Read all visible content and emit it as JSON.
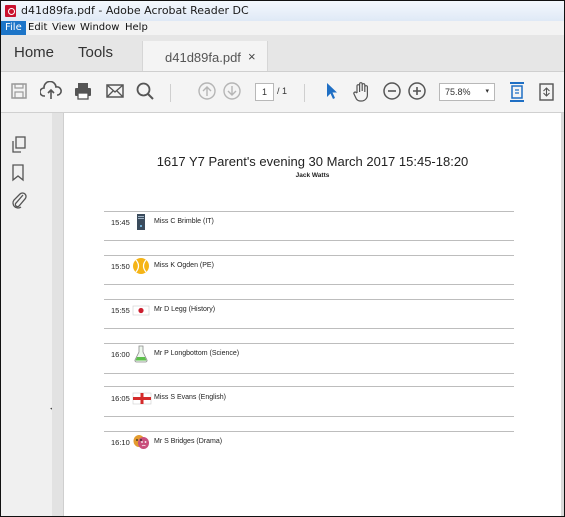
{
  "window": {
    "title": "d41d89fa.pdf - Adobe Acrobat Reader DC"
  },
  "menu": {
    "file": "File",
    "edit": "Edit",
    "view": "View",
    "window": "Window",
    "help": "Help"
  },
  "tabs": {
    "home": "Home",
    "tools": "Tools",
    "document": "d41d89fa.pdf",
    "close": "×"
  },
  "toolbar": {
    "page_current": "1",
    "page_total": "/ 1",
    "zoom": "75.8%",
    "zoom_arrow": "▾"
  },
  "sidebar": {
    "collapse": "◂"
  },
  "document": {
    "title": "1617 Y7 Parent's evening 30 March 2017 15:45-18:20",
    "student": "Jack Watts",
    "appointments": [
      {
        "time": "15:45",
        "teacher": "Miss C Brimble (IT)",
        "icon": "computer-tower-icon"
      },
      {
        "time": "15:50",
        "teacher": "Miss K Ogden (PE)",
        "icon": "tennis-ball-icon"
      },
      {
        "time": "15:55",
        "teacher": "Mr D Legg (History)",
        "icon": "japan-flag-icon"
      },
      {
        "time": "16:00",
        "teacher": "Mr P Longbottom (Science)",
        "icon": "flask-icon"
      },
      {
        "time": "16:05",
        "teacher": "Miss S Evans (English)",
        "icon": "england-flag-icon"
      },
      {
        "time": "16:10",
        "teacher": "Mr S Bridges (Drama)",
        "icon": "theatre-masks-icon"
      }
    ]
  }
}
